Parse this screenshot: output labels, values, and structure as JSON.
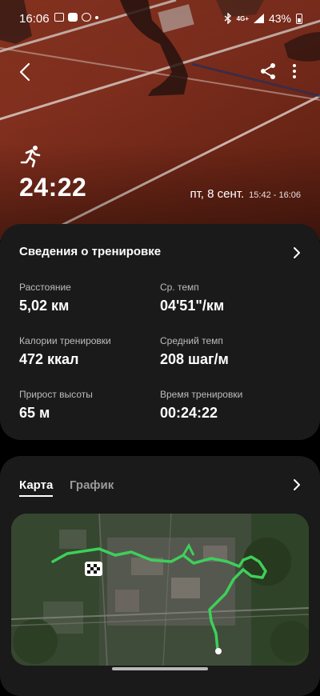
{
  "status_bar": {
    "time": "16:06",
    "network": "4G+",
    "battery": "43%"
  },
  "header": {
    "back_icon": "chevron-left-icon",
    "share_icon": "share-icon",
    "more_icon": "more-vertical-icon"
  },
  "workout": {
    "activity_icon": "running-icon",
    "duration": "24:22",
    "date": "пт, 8 сент.",
    "time_range": "15:42 - 16:06"
  },
  "details": {
    "title": "Сведения о тренировке",
    "stats": [
      {
        "label": "Расстояние",
        "value": "5,02 км"
      },
      {
        "label": "Ср. темп",
        "value": "04'51\"/км"
      },
      {
        "label": "Калории тренировки",
        "value": "472 ккал"
      },
      {
        "label": "Средний темп",
        "value": "208 шаг/м"
      },
      {
        "label": "Прирост высоты",
        "value": "65 м"
      },
      {
        "label": "Время тренировки",
        "value": "00:24:22"
      }
    ]
  },
  "map_card": {
    "tabs": [
      {
        "label": "Карта",
        "active": true
      },
      {
        "label": "График",
        "active": false
      }
    ]
  },
  "colors": {
    "card_bg": "#1a1a1a",
    "route": "#3ecf5a",
    "track": "#8a3220"
  }
}
